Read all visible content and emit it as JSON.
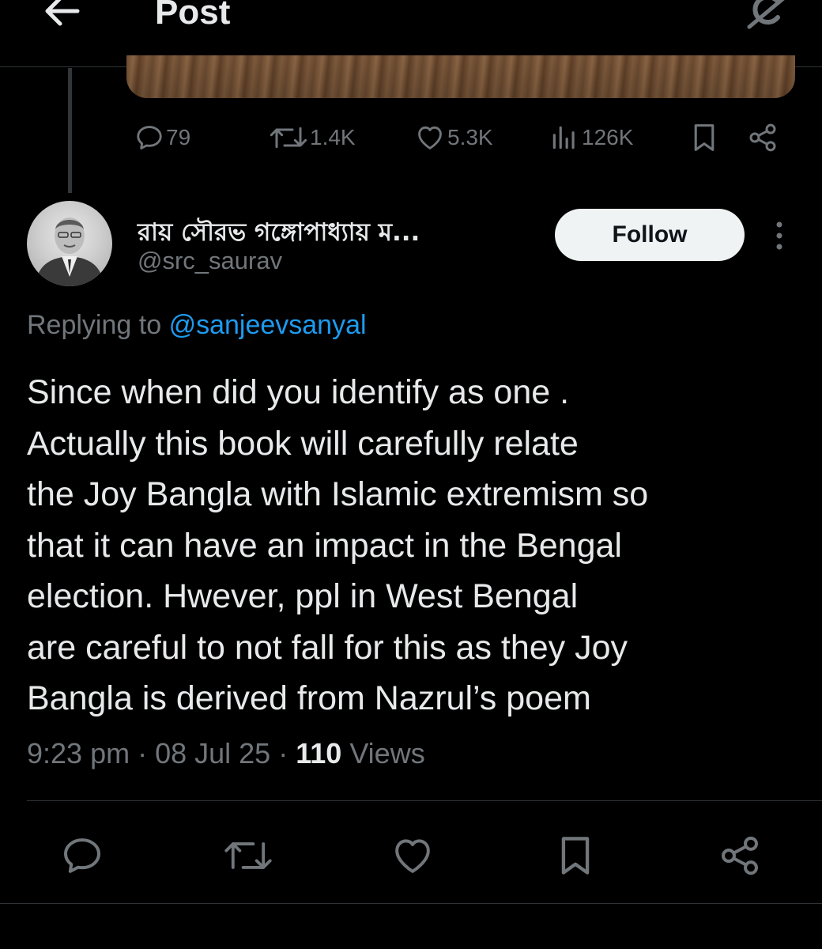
{
  "header": {
    "title": "Post",
    "back_icon": "arrow-left-icon",
    "grok_icon": "grok-icon"
  },
  "parent_tweet": {
    "actions": {
      "replies": "79",
      "reposts": "1.4K",
      "likes": "5.3K",
      "views": "126K"
    }
  },
  "reply": {
    "display_name": "রায় সৌরভ গঙ্গোপাধ্যায় ম...",
    "handle": "@src_saurav",
    "follow_label": "Follow",
    "replying_prefix": "Replying to",
    "replying_to": "@sanjeevsanyal",
    "text_lines": [
      "Since when did you identify as one .",
      "Actually this book will carefully relate",
      "the Joy Bangla with Islamic extremism so",
      "that it can have an impact in the Bengal",
      "election. Hwever, ppl in West Bengal",
      "are careful to not fall for this as they Joy",
      "Bangla is derived from Nazrul’s poem"
    ],
    "time": "9:23 pm",
    "date": "08 Jul 25",
    "views_count": "110",
    "views_label": "Views"
  },
  "colors": {
    "background": "#000000",
    "text": "#e7e9ea",
    "muted": "#71767b",
    "accent": "#1d9bf0",
    "divider": "#2f3336"
  }
}
